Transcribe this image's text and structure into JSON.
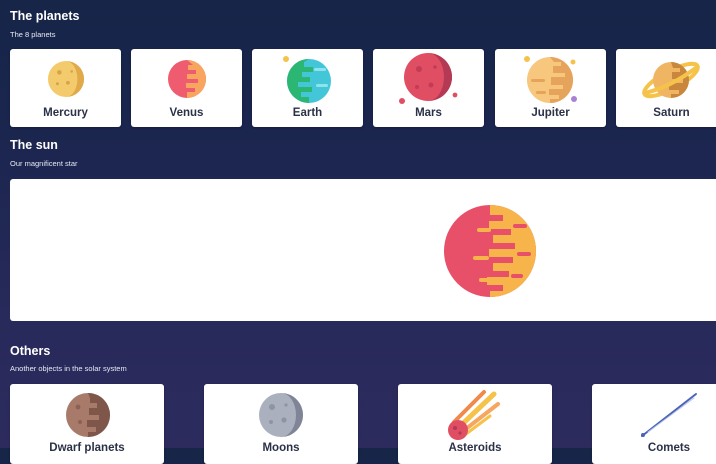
{
  "planets_section": {
    "title": "The planets",
    "subtitle": "The 8 planets",
    "items": [
      {
        "label": "Mercury",
        "icon": "mercury-icon"
      },
      {
        "label": "Venus",
        "icon": "venus-icon"
      },
      {
        "label": "Earth",
        "icon": "earth-icon"
      },
      {
        "label": "Mars",
        "icon": "mars-icon"
      },
      {
        "label": "Jupiter",
        "icon": "jupiter-icon"
      },
      {
        "label": "Saturn",
        "icon": "saturn-icon"
      }
    ]
  },
  "sun_section": {
    "title": "The sun",
    "subtitle": "Our magnificent star",
    "icon": "sun-icon"
  },
  "others_section": {
    "title": "Others",
    "subtitle": "Another objects in the solar system",
    "items": [
      {
        "label": "Dwarf planets",
        "icon": "dwarf-planet-icon"
      },
      {
        "label": "Moons",
        "icon": "moon-icon"
      },
      {
        "label": "Asteroids",
        "icon": "asteroid-icon"
      },
      {
        "label": "Comets",
        "icon": "comet-icon"
      }
    ]
  },
  "colors": {
    "background_top": "#162548",
    "background_bottom": "#2d2b5e",
    "card_background": "#ffffff",
    "card_text": "#2b3147"
  }
}
